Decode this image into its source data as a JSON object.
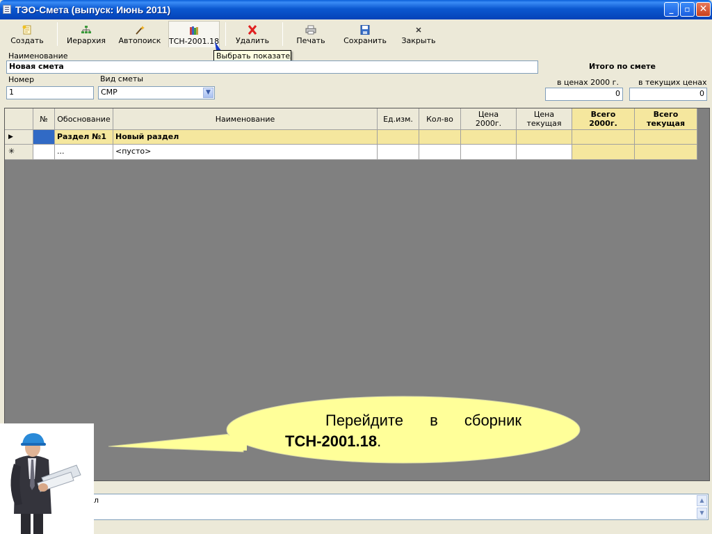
{
  "window": {
    "title": "ТЭО-Смета  (выпуск: Июнь 2011)",
    "min_label": "_",
    "max_label": "▫",
    "close_label": "✕"
  },
  "toolbar": {
    "create": "Создать",
    "hierarchy": "Иерархия",
    "autosearch": "Автопоиск",
    "tsn": "ТСН-2001.18",
    "delete": "Удалить",
    "print": "Печать",
    "save": "Сохранить",
    "close": "Закрыть"
  },
  "tooltip": "Выбрать показатель",
  "form": {
    "name_label": "Наименование",
    "name_value": "Новая смета",
    "number_label": "Номер",
    "number_value": "1",
    "type_label": "Вид сметы",
    "type_value": "СМР",
    "totals_title": "Итого по смете",
    "totals_2000_label": "в ценах 2000 г.",
    "totals_2000_value": "0",
    "totals_current_label": "в текущих ценах",
    "totals_current_value": "0"
  },
  "grid": {
    "headers": {
      "num": "№",
      "basis": "Обоснование",
      "name": "Наименование",
      "unit": "Ед.изм.",
      "qty": "Кол-во",
      "price2000_a": "Цена",
      "price2000_b": "2000г.",
      "pricecur_a": "Цена",
      "pricecur_b": "текущая",
      "total2000_a": "Всего",
      "total2000_b": "2000г.",
      "totalcur_a": "Всего",
      "totalcur_b": "текущая"
    },
    "rows": [
      {
        "marker": "▶",
        "basis": "Раздел №1",
        "name": "Новый раздел"
      },
      {
        "marker": "✳",
        "basis": "...",
        "name": "<пусто>"
      }
    ]
  },
  "bottom": {
    "text": "л"
  },
  "bubble": {
    "line1_words": [
      "Перейдите",
      "в",
      "сборник"
    ],
    "line2_bold": "ТСН-2001.18",
    "line2_tail": "."
  }
}
